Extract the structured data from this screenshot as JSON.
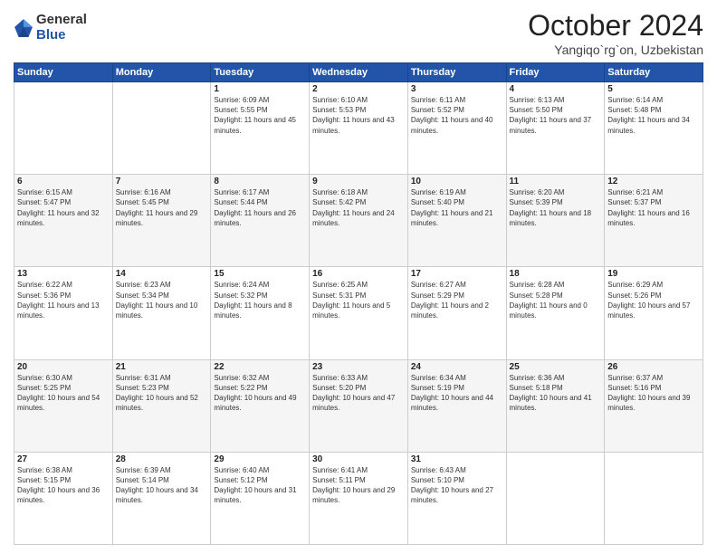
{
  "logo": {
    "general": "General",
    "blue": "Blue"
  },
  "header": {
    "month": "October 2024",
    "location": "Yangiqo`rg`on, Uzbekistan"
  },
  "weekdays": [
    "Sunday",
    "Monday",
    "Tuesday",
    "Wednesday",
    "Thursday",
    "Friday",
    "Saturday"
  ],
  "weeks": [
    [
      {
        "day": "",
        "sunrise": "",
        "sunset": "",
        "daylight": ""
      },
      {
        "day": "",
        "sunrise": "",
        "sunset": "",
        "daylight": ""
      },
      {
        "day": "1",
        "sunrise": "Sunrise: 6:09 AM",
        "sunset": "Sunset: 5:55 PM",
        "daylight": "Daylight: 11 hours and 45 minutes."
      },
      {
        "day": "2",
        "sunrise": "Sunrise: 6:10 AM",
        "sunset": "Sunset: 5:53 PM",
        "daylight": "Daylight: 11 hours and 43 minutes."
      },
      {
        "day": "3",
        "sunrise": "Sunrise: 6:11 AM",
        "sunset": "Sunset: 5:52 PM",
        "daylight": "Daylight: 11 hours and 40 minutes."
      },
      {
        "day": "4",
        "sunrise": "Sunrise: 6:13 AM",
        "sunset": "Sunset: 5:50 PM",
        "daylight": "Daylight: 11 hours and 37 minutes."
      },
      {
        "day": "5",
        "sunrise": "Sunrise: 6:14 AM",
        "sunset": "Sunset: 5:48 PM",
        "daylight": "Daylight: 11 hours and 34 minutes."
      }
    ],
    [
      {
        "day": "6",
        "sunrise": "Sunrise: 6:15 AM",
        "sunset": "Sunset: 5:47 PM",
        "daylight": "Daylight: 11 hours and 32 minutes."
      },
      {
        "day": "7",
        "sunrise": "Sunrise: 6:16 AM",
        "sunset": "Sunset: 5:45 PM",
        "daylight": "Daylight: 11 hours and 29 minutes."
      },
      {
        "day": "8",
        "sunrise": "Sunrise: 6:17 AM",
        "sunset": "Sunset: 5:44 PM",
        "daylight": "Daylight: 11 hours and 26 minutes."
      },
      {
        "day": "9",
        "sunrise": "Sunrise: 6:18 AM",
        "sunset": "Sunset: 5:42 PM",
        "daylight": "Daylight: 11 hours and 24 minutes."
      },
      {
        "day": "10",
        "sunrise": "Sunrise: 6:19 AM",
        "sunset": "Sunset: 5:40 PM",
        "daylight": "Daylight: 11 hours and 21 minutes."
      },
      {
        "day": "11",
        "sunrise": "Sunrise: 6:20 AM",
        "sunset": "Sunset: 5:39 PM",
        "daylight": "Daylight: 11 hours and 18 minutes."
      },
      {
        "day": "12",
        "sunrise": "Sunrise: 6:21 AM",
        "sunset": "Sunset: 5:37 PM",
        "daylight": "Daylight: 11 hours and 16 minutes."
      }
    ],
    [
      {
        "day": "13",
        "sunrise": "Sunrise: 6:22 AM",
        "sunset": "Sunset: 5:36 PM",
        "daylight": "Daylight: 11 hours and 13 minutes."
      },
      {
        "day": "14",
        "sunrise": "Sunrise: 6:23 AM",
        "sunset": "Sunset: 5:34 PM",
        "daylight": "Daylight: 11 hours and 10 minutes."
      },
      {
        "day": "15",
        "sunrise": "Sunrise: 6:24 AM",
        "sunset": "Sunset: 5:32 PM",
        "daylight": "Daylight: 11 hours and 8 minutes."
      },
      {
        "day": "16",
        "sunrise": "Sunrise: 6:25 AM",
        "sunset": "Sunset: 5:31 PM",
        "daylight": "Daylight: 11 hours and 5 minutes."
      },
      {
        "day": "17",
        "sunrise": "Sunrise: 6:27 AM",
        "sunset": "Sunset: 5:29 PM",
        "daylight": "Daylight: 11 hours and 2 minutes."
      },
      {
        "day": "18",
        "sunrise": "Sunrise: 6:28 AM",
        "sunset": "Sunset: 5:28 PM",
        "daylight": "Daylight: 11 hours and 0 minutes."
      },
      {
        "day": "19",
        "sunrise": "Sunrise: 6:29 AM",
        "sunset": "Sunset: 5:26 PM",
        "daylight": "Daylight: 10 hours and 57 minutes."
      }
    ],
    [
      {
        "day": "20",
        "sunrise": "Sunrise: 6:30 AM",
        "sunset": "Sunset: 5:25 PM",
        "daylight": "Daylight: 10 hours and 54 minutes."
      },
      {
        "day": "21",
        "sunrise": "Sunrise: 6:31 AM",
        "sunset": "Sunset: 5:23 PM",
        "daylight": "Daylight: 10 hours and 52 minutes."
      },
      {
        "day": "22",
        "sunrise": "Sunrise: 6:32 AM",
        "sunset": "Sunset: 5:22 PM",
        "daylight": "Daylight: 10 hours and 49 minutes."
      },
      {
        "day": "23",
        "sunrise": "Sunrise: 6:33 AM",
        "sunset": "Sunset: 5:20 PM",
        "daylight": "Daylight: 10 hours and 47 minutes."
      },
      {
        "day": "24",
        "sunrise": "Sunrise: 6:34 AM",
        "sunset": "Sunset: 5:19 PM",
        "daylight": "Daylight: 10 hours and 44 minutes."
      },
      {
        "day": "25",
        "sunrise": "Sunrise: 6:36 AM",
        "sunset": "Sunset: 5:18 PM",
        "daylight": "Daylight: 10 hours and 41 minutes."
      },
      {
        "day": "26",
        "sunrise": "Sunrise: 6:37 AM",
        "sunset": "Sunset: 5:16 PM",
        "daylight": "Daylight: 10 hours and 39 minutes."
      }
    ],
    [
      {
        "day": "27",
        "sunrise": "Sunrise: 6:38 AM",
        "sunset": "Sunset: 5:15 PM",
        "daylight": "Daylight: 10 hours and 36 minutes."
      },
      {
        "day": "28",
        "sunrise": "Sunrise: 6:39 AM",
        "sunset": "Sunset: 5:14 PM",
        "daylight": "Daylight: 10 hours and 34 minutes."
      },
      {
        "day": "29",
        "sunrise": "Sunrise: 6:40 AM",
        "sunset": "Sunset: 5:12 PM",
        "daylight": "Daylight: 10 hours and 31 minutes."
      },
      {
        "day": "30",
        "sunrise": "Sunrise: 6:41 AM",
        "sunset": "Sunset: 5:11 PM",
        "daylight": "Daylight: 10 hours and 29 minutes."
      },
      {
        "day": "31",
        "sunrise": "Sunrise: 6:43 AM",
        "sunset": "Sunset: 5:10 PM",
        "daylight": "Daylight: 10 hours and 27 minutes."
      },
      {
        "day": "",
        "sunrise": "",
        "sunset": "",
        "daylight": ""
      },
      {
        "day": "",
        "sunrise": "",
        "sunset": "",
        "daylight": ""
      }
    ]
  ]
}
